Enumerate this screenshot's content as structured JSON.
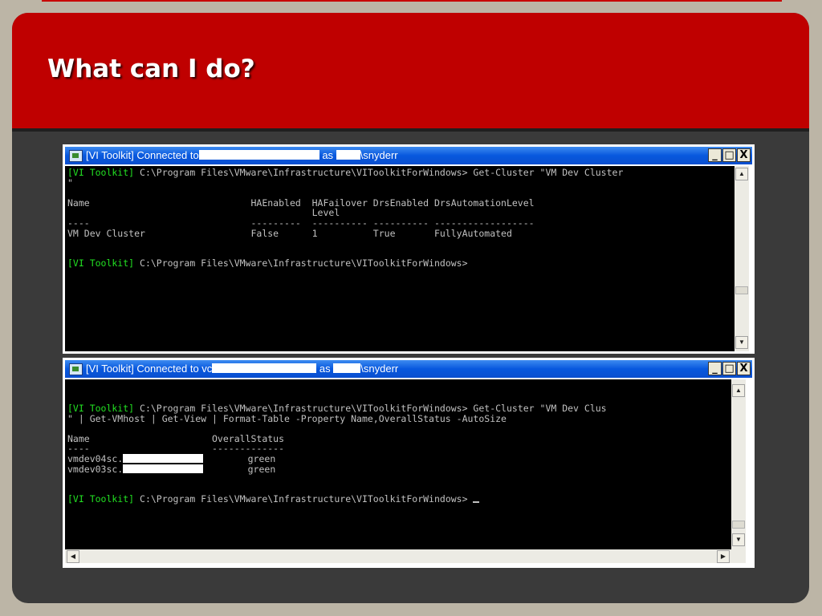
{
  "slide": {
    "title": "What can I do?"
  },
  "window1": {
    "title_prefix": "[VI Toolkit] Connected to",
    "title_as": "as",
    "title_user": "\\snyderr",
    "controls": {
      "minimize": "_",
      "maximize": "□",
      "close": "X"
    },
    "lines": [
      {
        "prefix": "[VI Toolkit]",
        "text": " C:\\Program Files\\VMware\\Infrastructure\\VIToolkitForWindows> Get-Cluster \"VM Dev Cluster"
      },
      {
        "prefix": "",
        "text": "\""
      },
      {
        "prefix": "",
        "text": ""
      },
      {
        "prefix": "",
        "text": "Name                             HAEnabled  HAFailover DrsEnabled DrsAutomationLevel"
      },
      {
        "prefix": "",
        "text": "                                            Level"
      },
      {
        "prefix": "",
        "text": "----                             ---------  ---------- ---------- ------------------"
      },
      {
        "prefix": "",
        "text": "VM Dev Cluster                   False      1          True       FullyAutomated"
      },
      {
        "prefix": "",
        "text": ""
      },
      {
        "prefix": "",
        "text": ""
      },
      {
        "prefix": "[VI Toolkit]",
        "text": " C:\\Program Files\\VMware\\Infrastructure\\VIToolkitForWindows>"
      }
    ]
  },
  "window2": {
    "title_prefix": "[VI Toolkit] Connected to vc",
    "title_as": "as",
    "title_user": "\\snyderr",
    "controls": {
      "minimize": "_",
      "maximize": "□",
      "close": "X"
    },
    "lines": [
      {
        "prefix": "[VI Toolkit]",
        "text": " C:\\Program Files\\VMware\\Infrastructure\\VIToolkitForWindows> Get-Cluster \"VM Dev Clus"
      },
      {
        "prefix": "",
        "text": "\" | Get-VMhost | Get-View | Format-Table -Property Name,OverallStatus -AutoSize"
      },
      {
        "prefix": "",
        "text": ""
      },
      {
        "prefix": "",
        "text": "Name                      OverallStatus"
      },
      {
        "prefix": "",
        "text": "----                      -------------"
      },
      {
        "prefix": "",
        "text": "vmdev04sc.",
        "suffix": "        green"
      },
      {
        "prefix": "",
        "text": "vmdev03sc.",
        "suffix": "        green"
      },
      {
        "prefix": "",
        "text": ""
      },
      {
        "prefix": "",
        "text": ""
      },
      {
        "prefix": "[VI Toolkit]",
        "text": " C:\\Program Files\\VMware\\Infrastructure\\VIToolkitForWindows> ",
        "cursor": true
      }
    ]
  }
}
